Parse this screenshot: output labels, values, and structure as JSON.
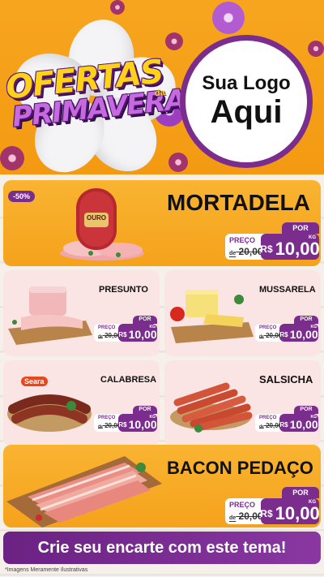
{
  "header": {
    "title_line1": "OFERTAS",
    "title_da": "da",
    "title_line2": "PRIMAVERA",
    "logo_line1": "Sua Logo",
    "logo_line2": "Aqui"
  },
  "featured": {
    "badge": "-50%",
    "brand": "OURO",
    "name": "MORTADELA",
    "por": "POR",
    "preco_label": "PREÇO",
    "de": "de",
    "old_price": "20,00",
    "currency": "R$",
    "price": "10,00",
    "unit": "KG"
  },
  "products": [
    {
      "name": "PRESUNTO",
      "por": "POR",
      "preco_label": "PREÇO",
      "de": "de",
      "old_price": "20,00",
      "currency": "R$",
      "price": "10,00",
      "unit": "KG"
    },
    {
      "name": "MUSSARELA",
      "por": "POR",
      "preco_label": "PREÇO",
      "de": "de",
      "old_price": "20,00",
      "currency": "R$",
      "price": "10,00",
      "unit": "KG"
    },
    {
      "name": "CALABRESA",
      "brand": "Seara",
      "por": "POR",
      "preco_label": "PREÇO",
      "de": "de",
      "old_price": "20,00",
      "currency": "R$",
      "price": "10,00",
      "unit": "KG"
    },
    {
      "name": "SALSICHA",
      "por": "POR",
      "preco_label": "PREÇO",
      "de": "de",
      "old_price": "20,00",
      "currency": "R$",
      "price": "10,00",
      "unit": "KG"
    }
  ],
  "bacon": {
    "name": "BACON PEDAÇO",
    "por": "POR",
    "preco_label": "PREÇO",
    "de": "de",
    "old_price": "20,00",
    "currency": "R$",
    "price": "10,00",
    "unit": "KG"
  },
  "cta": "Crie seu encarte com este tema!",
  "disclaimer": "*Imagens Meramente Ilustrativas",
  "colors": {
    "orange": "#f5a21c",
    "purple": "#7b2d8e",
    "pink_panel": "#fbe4e4"
  }
}
